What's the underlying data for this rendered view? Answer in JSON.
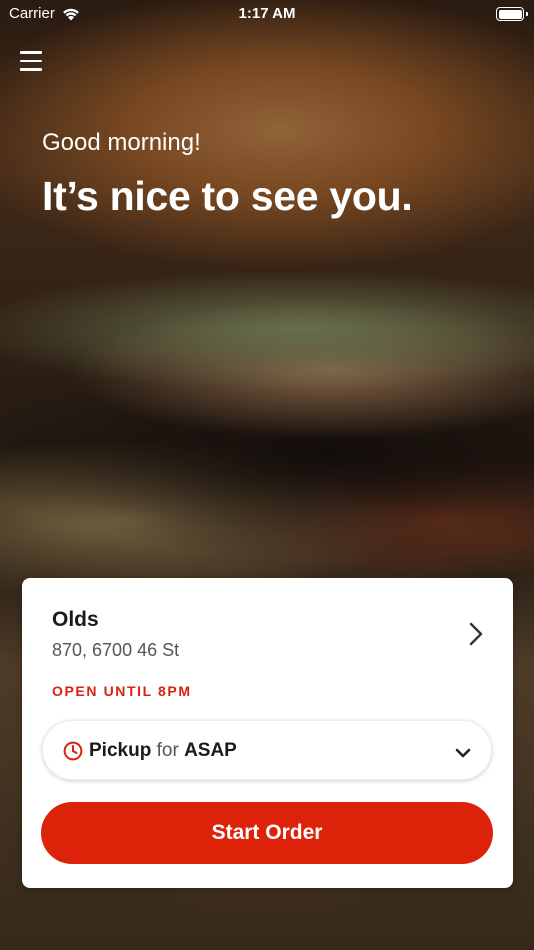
{
  "status_bar": {
    "carrier": "Carrier",
    "time": "1:17 AM",
    "battery_level": 1.0
  },
  "header": {
    "menu_icon": "hamburger-menu-icon",
    "greeting": "Good morning!",
    "headline": "It’s nice to see you."
  },
  "store": {
    "name": "Olds",
    "address": "870, 6700 46 St",
    "open_status": "OPEN UNTIL 8PM"
  },
  "pickup": {
    "icon": "clock-icon",
    "mode": "Pickup",
    "connector": "for",
    "time": "ASAP"
  },
  "actions": {
    "start_order_label": "Start Order"
  },
  "colors": {
    "accent": "#dc2209",
    "text_dark": "#1b1b1b",
    "text_muted": "#555555",
    "card_bg": "#ffffff"
  }
}
